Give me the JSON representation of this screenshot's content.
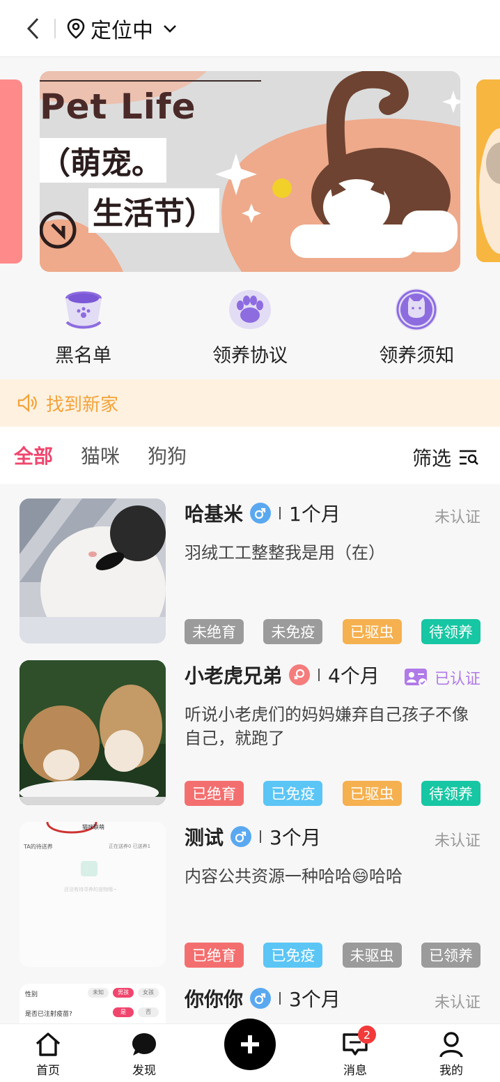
{
  "header": {
    "location": "定位中"
  },
  "banner": {
    "title": "Pet Life",
    "line1": "（萌宠。",
    "line2": "生活节）"
  },
  "entries": [
    {
      "label": "黑名单",
      "icon": "bowl-icon"
    },
    {
      "label": "领养协议",
      "icon": "paw-icon"
    },
    {
      "label": "领养须知",
      "icon": "cat-badge-icon"
    }
  ],
  "notice": {
    "text": "找到新家"
  },
  "tabs": [
    "全部",
    "猫咪",
    "狗狗"
  ],
  "filter_label": "筛选",
  "pets": [
    {
      "name": "哈基米",
      "gender": "male",
      "age": "1个月",
      "cert": "未认证",
      "certified": false,
      "desc": "羽绒工工整整我是用（在）",
      "tags": [
        {
          "text": "未绝育",
          "color": "#9b9b9b"
        },
        {
          "text": "未免疫",
          "color": "#9b9b9b"
        },
        {
          "text": "已驱虫",
          "color": "#f5b04f"
        },
        {
          "text": "待领养",
          "color": "#17c6a3"
        }
      ]
    },
    {
      "name": "小老虎兄弟",
      "gender": "female",
      "age": "4个月",
      "cert": "已认证",
      "certified": true,
      "desc": "听说小老虎们的妈妈嫌弃自己孩子不像自己，就跑了",
      "tags": [
        {
          "text": "已绝育",
          "color": "#f36f6f"
        },
        {
          "text": "已免疫",
          "color": "#5bc5f5"
        },
        {
          "text": "已驱虫",
          "color": "#f5b04f"
        },
        {
          "text": "待领养",
          "color": "#17c6a3"
        }
      ]
    },
    {
      "name": "测试",
      "gender": "male",
      "age": "3个月",
      "cert": "未认证",
      "certified": false,
      "desc": "内容公共资源一种哈哈😄哈哈",
      "tags": [
        {
          "text": "已绝育",
          "color": "#f36f6f"
        },
        {
          "text": "已免疫",
          "color": "#5bc5f5"
        },
        {
          "text": "未驱虫",
          "color": "#9b9b9b"
        },
        {
          "text": "已领养",
          "color": "#9b9b9b"
        }
      ]
    },
    {
      "name": "你你你",
      "gender": "male",
      "age": "3个月",
      "cert": "未认证",
      "certified": false,
      "desc": "",
      "tags": []
    }
  ],
  "thumb3_texts": {
    "title": "猫咪联萌",
    "left": "TA的待送养",
    "right": "正在送养0  已送养1",
    "empty": "还没有待寻养的宠物哦~"
  },
  "thumb4_texts": {
    "gender_label": "性别",
    "opt1": "未知",
    "opt2": "男孩",
    "opt3": "女孩",
    "vacc_label": "是否已注射疫苗?",
    "yes": "是",
    "no": "否"
  },
  "nav": {
    "home": "首页",
    "discover": "发现",
    "messages": "消息",
    "messages_badge": "2",
    "mine": "我的"
  }
}
